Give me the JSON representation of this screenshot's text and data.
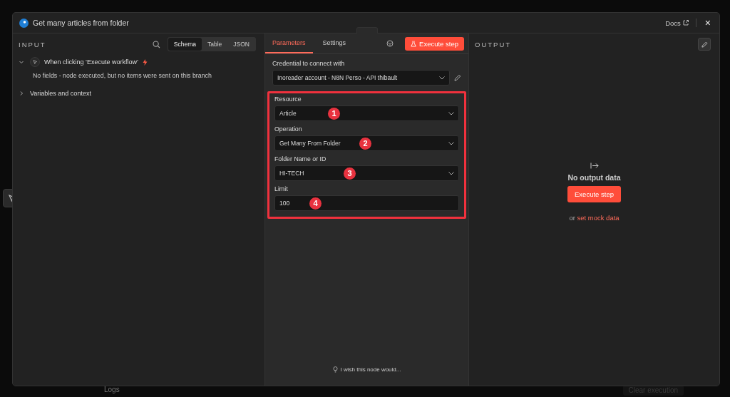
{
  "window": {
    "title": "Get many articles from folder",
    "docs_link": "Docs",
    "close": "×"
  },
  "input": {
    "title": "INPUT",
    "views": [
      {
        "label": "Schema",
        "selected": true
      },
      {
        "label": "Table",
        "selected": false
      },
      {
        "label": "JSON",
        "selected": false
      }
    ],
    "tree": [
      {
        "label": "When clicking ‘Execute workflow’",
        "expanded": true,
        "pinned": true,
        "note": "No fields - node executed, but no items were sent on this branch"
      },
      {
        "label": "Variables and context",
        "expanded": false
      }
    ]
  },
  "parameters": {
    "tabs": [
      {
        "label": "Parameters",
        "selected": true
      },
      {
        "label": "Settings",
        "selected": false
      }
    ],
    "execute_button": "Execute step",
    "credential": {
      "label": "Credential to connect with",
      "value": "Inoreader account - N8N Perso - API thibault"
    },
    "fields": [
      {
        "label": "Resource",
        "value": "Article",
        "kind": "select",
        "badge": "1"
      },
      {
        "label": "Operation",
        "value": "Get Many From Folder",
        "kind": "select",
        "badge": "2"
      },
      {
        "label": "Folder Name or ID",
        "value": "HI-TECH",
        "kind": "select",
        "badge": "3"
      },
      {
        "label": "Limit",
        "value": "100",
        "kind": "input",
        "badge": "4"
      }
    ],
    "feedback_link": "I wish this node would..."
  },
  "output": {
    "title": "OUTPUT",
    "empty_title": "No output data",
    "execute_button": "Execute step",
    "mock_prefix": "or",
    "mock_link": "set mock data"
  },
  "background": {
    "logs_tab": "Logs",
    "clear_button": "Clear execution"
  }
}
